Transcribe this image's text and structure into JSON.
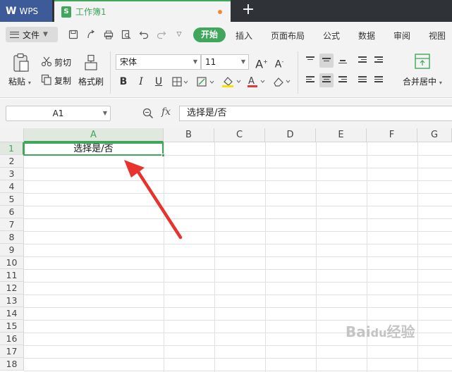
{
  "titlebar": {
    "app_name": "WPS",
    "doc_title": "工作簿1",
    "new_tab_symbol": "+"
  },
  "menubar": {
    "file_label": "文件",
    "tabs": [
      "开始",
      "插入",
      "页面布局",
      "公式",
      "数据",
      "审阅",
      "视图"
    ],
    "active_tab": "开始",
    "accent_color": "#3fa65b"
  },
  "ribbon": {
    "paste_label": "粘贴",
    "cut_label": "剪切",
    "copy_label": "复制",
    "format_painter_label": "格式刷",
    "font_name": "宋体",
    "font_size": "11",
    "bold_label": "B",
    "italic_label": "I",
    "underline_label": "U",
    "merge_label": "合并居中"
  },
  "formula_bar": {
    "name_box": "A1",
    "fx_label": "fx",
    "formula_value": "选择是/否"
  },
  "sheet": {
    "columns": [
      "A",
      "B",
      "C",
      "D",
      "E",
      "F",
      "G"
    ],
    "rows": [
      "1",
      "2",
      "3",
      "4",
      "5",
      "6",
      "7",
      "8",
      "9",
      "10",
      "11",
      "12",
      "13",
      "14",
      "15",
      "16",
      "17",
      "18"
    ],
    "active_cell": "A1",
    "cells": {
      "A1": "选择是/否"
    }
  }
}
